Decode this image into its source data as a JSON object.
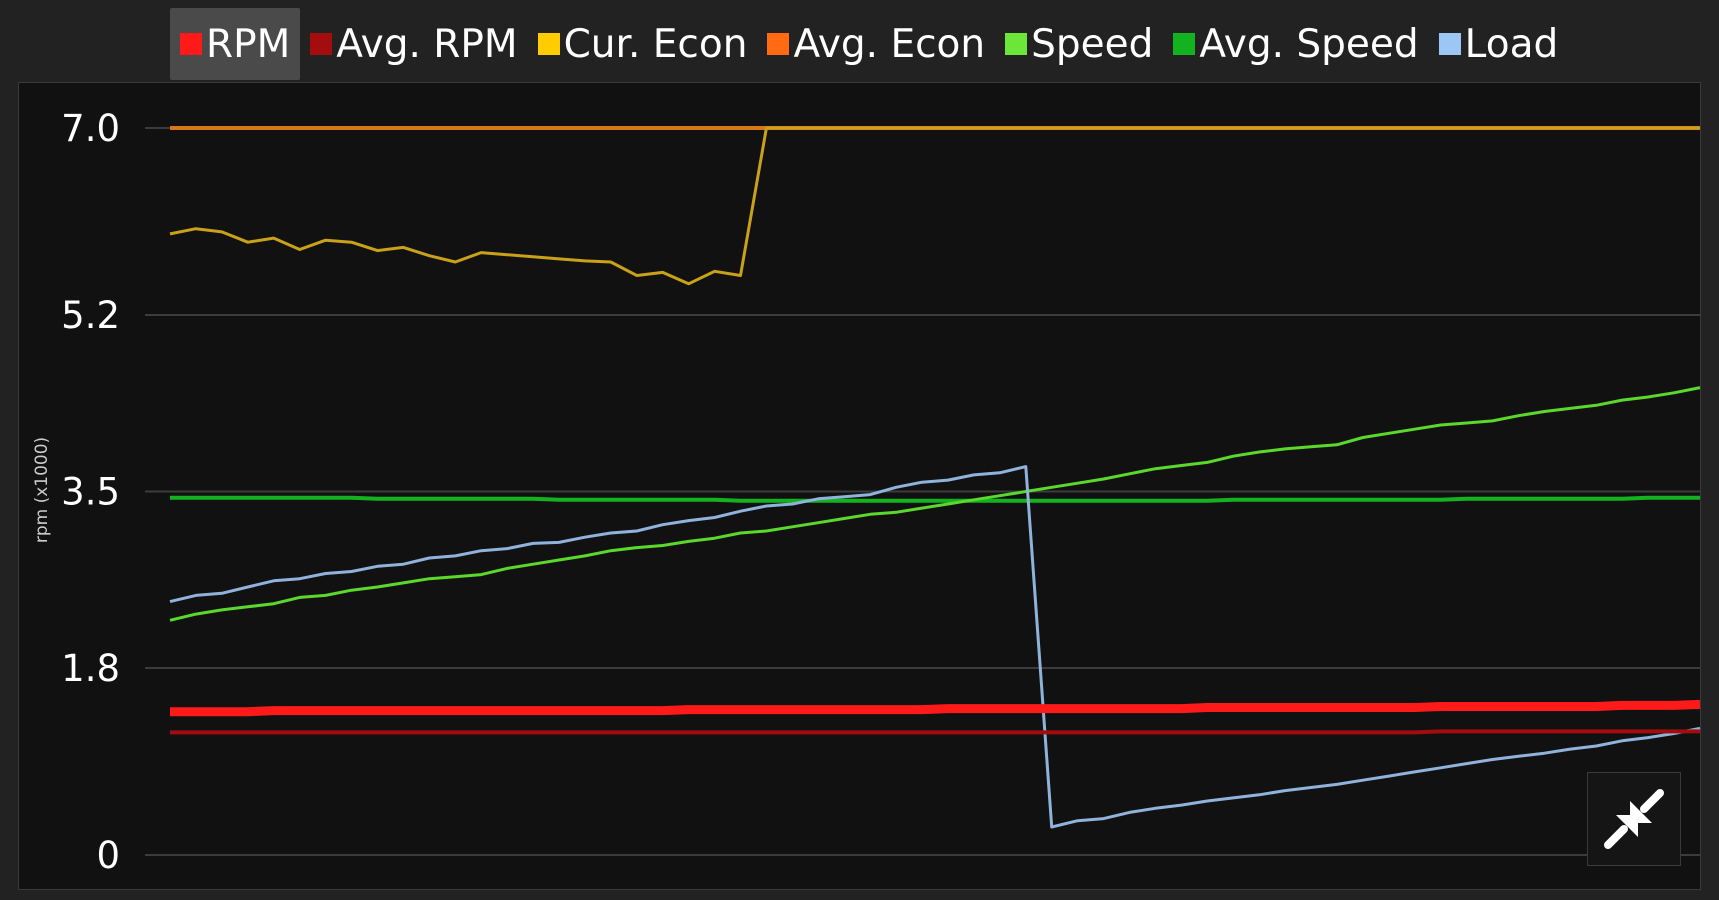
{
  "legend": [
    {
      "label": "RPM",
      "color": "#ff1a1a",
      "active": true
    },
    {
      "label": "Avg. RPM",
      "color": "#a30d0d",
      "active": false
    },
    {
      "label": "Cur. Econ",
      "color": "#ffcc00",
      "active": false
    },
    {
      "label": "Avg. Econ",
      "color": "#ff6a12",
      "active": false
    },
    {
      "label": "Speed",
      "color": "#6de63a",
      "active": false
    },
    {
      "label": "Avg. Speed",
      "color": "#13b320",
      "active": false
    },
    {
      "label": "Load",
      "color": "#9cc7f5",
      "active": false
    }
  ],
  "restore_button_icon": "collapse-arrows-icon",
  "chart_data": {
    "type": "line",
    "ylabel": "rpm (x1000)",
    "yticks": [
      "7.0",
      "5.2",
      "3.5",
      "1.8",
      "0"
    ],
    "ylim": [
      0,
      7.0
    ],
    "grid": true,
    "legend_position": "top",
    "x": [
      1,
      2,
      3,
      4,
      5,
      6,
      7,
      8,
      9,
      10,
      11,
      12,
      13,
      14,
      15,
      16,
      17,
      18,
      19,
      20,
      21,
      22,
      23,
      24,
      25,
      26,
      27,
      28,
      29,
      30,
      31,
      32,
      33,
      34,
      35,
      36,
      37,
      38,
      39,
      40,
      41,
      42,
      43,
      44,
      45,
      46,
      47,
      48,
      49,
      50,
      51,
      52,
      53,
      54,
      55,
      56,
      57,
      58,
      59,
      60
    ],
    "series": [
      {
        "name": "RPM",
        "color": "#ff1a1a",
        "width": 9,
        "values": [
          1.38,
          1.38,
          1.38,
          1.38,
          1.39,
          1.39,
          1.39,
          1.39,
          1.39,
          1.39,
          1.39,
          1.39,
          1.39,
          1.39,
          1.39,
          1.39,
          1.39,
          1.39,
          1.39,
          1.39,
          1.4,
          1.4,
          1.4,
          1.4,
          1.4,
          1.4,
          1.4,
          1.4,
          1.4,
          1.4,
          1.41,
          1.41,
          1.41,
          1.41,
          1.41,
          1.41,
          1.41,
          1.41,
          1.41,
          1.41,
          1.42,
          1.42,
          1.42,
          1.42,
          1.42,
          1.42,
          1.42,
          1.42,
          1.42,
          1.43,
          1.43,
          1.43,
          1.43,
          1.43,
          1.43,
          1.43,
          1.44,
          1.44,
          1.44,
          1.45
        ]
      },
      {
        "name": "Avg. RPM",
        "color": "#a30d0d",
        "width": 4,
        "values": [
          1.18,
          1.18,
          1.18,
          1.18,
          1.18,
          1.18,
          1.18,
          1.18,
          1.18,
          1.18,
          1.18,
          1.18,
          1.18,
          1.18,
          1.18,
          1.18,
          1.18,
          1.18,
          1.18,
          1.18,
          1.18,
          1.18,
          1.18,
          1.18,
          1.18,
          1.18,
          1.18,
          1.18,
          1.18,
          1.18,
          1.18,
          1.18,
          1.18,
          1.18,
          1.18,
          1.18,
          1.18,
          1.18,
          1.18,
          1.18,
          1.18,
          1.18,
          1.18,
          1.18,
          1.18,
          1.18,
          1.18,
          1.18,
          1.18,
          1.19,
          1.19,
          1.19,
          1.19,
          1.19,
          1.19,
          1.19,
          1.19,
          1.19,
          1.19,
          1.19
        ]
      },
      {
        "name": "Cur. Econ",
        "color": "#c9a21a",
        "width": 3,
        "values": [
          5.98,
          6.03,
          6.0,
          5.9,
          5.94,
          5.83,
          5.92,
          5.9,
          5.82,
          5.85,
          5.77,
          5.71,
          5.8,
          5.78,
          5.76,
          5.74,
          5.72,
          5.71,
          5.58,
          5.61,
          5.5,
          5.62,
          5.58,
          7.0,
          7.0,
          7.0,
          7.0,
          7.0,
          7.0,
          7.0,
          7.0,
          7.0,
          7.0,
          7.0,
          7.0,
          7.0,
          7.0,
          7.0,
          7.0,
          7.0,
          7.0,
          7.0,
          7.0,
          7.0,
          7.0,
          7.0,
          7.0,
          7.0,
          7.0,
          7.0,
          7.0,
          7.0,
          7.0,
          7.0,
          7.0,
          7.0,
          7.0,
          7.0,
          7.0,
          7.0
        ]
      },
      {
        "name": "Avg. Econ",
        "color": "#d9761a",
        "width": 4,
        "values": [
          7.0,
          7.0,
          7.0,
          7.0,
          7.0,
          7.0,
          7.0,
          7.0,
          7.0,
          7.0,
          7.0,
          7.0,
          7.0,
          7.0,
          7.0,
          7.0,
          7.0,
          7.0,
          7.0,
          7.0,
          7.0,
          7.0,
          7.0,
          7.0,
          7.0,
          7.0,
          7.0,
          7.0,
          7.0,
          7.0,
          7.0,
          7.0,
          7.0,
          7.0,
          7.0,
          7.0,
          7.0,
          7.0,
          7.0,
          7.0,
          7.0,
          7.0,
          7.0,
          7.0,
          7.0,
          7.0,
          7.0,
          7.0,
          7.0,
          7.0,
          7.0,
          7.0,
          7.0,
          7.0,
          7.0,
          7.0,
          7.0,
          7.0,
          7.0,
          7.0
        ]
      },
      {
        "name": "Speed",
        "color": "#5bd82c",
        "width": 3,
        "values": [
          2.26,
          2.32,
          2.36,
          2.39,
          2.42,
          2.48,
          2.5,
          2.55,
          2.58,
          2.62,
          2.66,
          2.68,
          2.7,
          2.76,
          2.8,
          2.84,
          2.88,
          2.93,
          2.96,
          2.98,
          3.02,
          3.05,
          3.1,
          3.12,
          3.16,
          3.2,
          3.24,
          3.28,
          3.3,
          3.34,
          3.38,
          3.42,
          3.46,
          3.5,
          3.54,
          3.58,
          3.62,
          3.67,
          3.72,
          3.75,
          3.78,
          3.84,
          3.88,
          3.91,
          3.93,
          3.95,
          4.02,
          4.06,
          4.1,
          4.14,
          4.16,
          4.18,
          4.23,
          4.27,
          4.3,
          4.33,
          4.38,
          4.41,
          4.45,
          4.5
        ]
      },
      {
        "name": "Avg. Speed",
        "color": "#13b320",
        "width": 4,
        "values": [
          3.44,
          3.44,
          3.44,
          3.44,
          3.44,
          3.44,
          3.44,
          3.44,
          3.43,
          3.43,
          3.43,
          3.43,
          3.43,
          3.43,
          3.43,
          3.42,
          3.42,
          3.42,
          3.42,
          3.42,
          3.42,
          3.42,
          3.41,
          3.41,
          3.41,
          3.41,
          3.41,
          3.41,
          3.41,
          3.41,
          3.41,
          3.41,
          3.41,
          3.41,
          3.41,
          3.41,
          3.41,
          3.41,
          3.41,
          3.41,
          3.41,
          3.42,
          3.42,
          3.42,
          3.42,
          3.42,
          3.42,
          3.42,
          3.42,
          3.42,
          3.43,
          3.43,
          3.43,
          3.43,
          3.43,
          3.43,
          3.43,
          3.44,
          3.44,
          3.44
        ]
      },
      {
        "name": "Load",
        "color": "#8fb3db",
        "width": 3,
        "values": [
          2.44,
          2.5,
          2.52,
          2.58,
          2.64,
          2.66,
          2.71,
          2.73,
          2.78,
          2.8,
          2.86,
          2.88,
          2.93,
          2.95,
          3.0,
          3.01,
          3.06,
          3.1,
          3.12,
          3.18,
          3.22,
          3.25,
          3.31,
          3.36,
          3.38,
          3.43,
          3.45,
          3.47,
          3.54,
          3.59,
          3.61,
          3.66,
          3.68,
          3.74,
          0.27,
          0.33,
          0.35,
          0.41,
          0.45,
          0.48,
          0.52,
          0.55,
          0.58,
          0.62,
          0.65,
          0.68,
          0.72,
          0.76,
          0.8,
          0.84,
          0.88,
          0.92,
          0.95,
          0.98,
          1.02,
          1.05,
          1.1,
          1.13,
          1.17,
          1.22
        ]
      }
    ]
  }
}
